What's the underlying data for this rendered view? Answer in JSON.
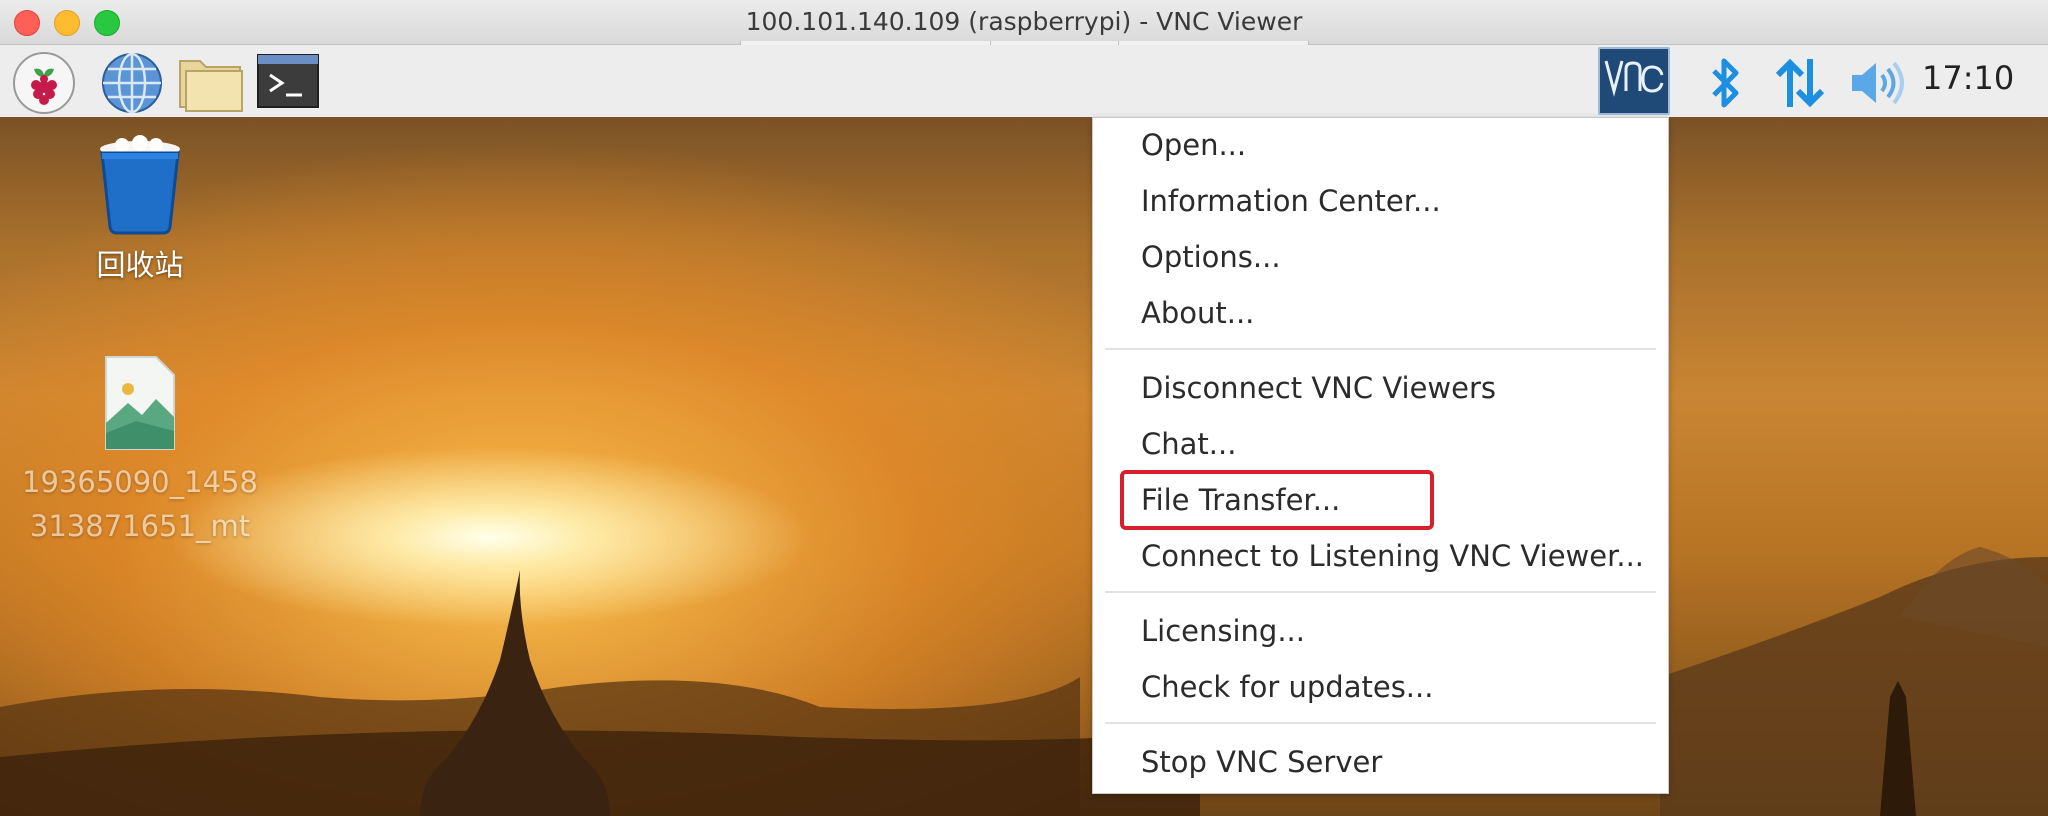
{
  "window": {
    "title": "100.101.140.109 (raspberrypi) - VNC Viewer"
  },
  "panel": {
    "launchers": [
      {
        "icon": "raspberry-pi-menu-icon"
      },
      {
        "icon": "web-browser-icon"
      },
      {
        "icon": "file-manager-icon"
      },
      {
        "icon": "terminal-icon"
      }
    ],
    "tray": [
      {
        "icon": "vnc-server-icon"
      },
      {
        "icon": "bluetooth-icon"
      },
      {
        "icon": "network-icon"
      },
      {
        "icon": "volume-icon"
      }
    ],
    "clock": "17:10"
  },
  "desktop": {
    "icons": [
      {
        "label": "回收站",
        "icon": "trash-icon"
      },
      {
        "label_line1": "19365090_1458",
        "label_line2": "313871651_mt",
        "icon": "image-file-icon"
      }
    ]
  },
  "menu": {
    "items": [
      "Open...",
      "Information Center...",
      "Options...",
      "About...",
      "Disconnect VNC Viewers",
      "Chat...",
      "File Transfer...",
      "Connect to Listening VNC Viewer...",
      "Licensing...",
      "Check for updates...",
      "Stop VNC Server"
    ],
    "highlighted_item": "File Transfer...",
    "highlight_color": "#d6202c"
  },
  "colors": {
    "vnc_tray_bg": "#1f4a78",
    "bluetooth": "#1d8fe0"
  }
}
